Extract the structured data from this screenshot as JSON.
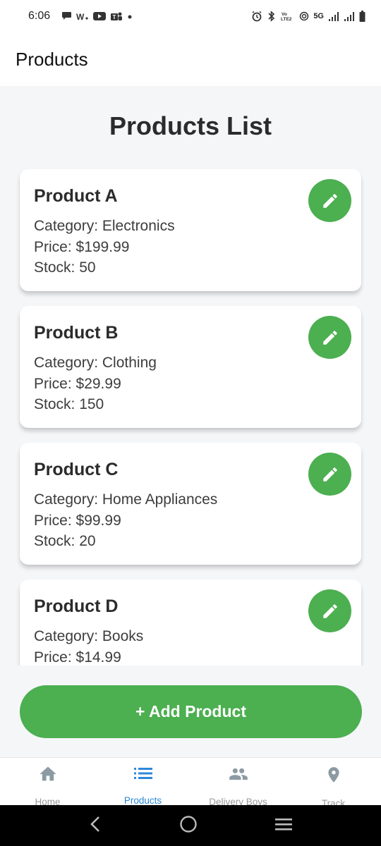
{
  "status_bar": {
    "time": "6:06",
    "network": "5G"
  },
  "app_bar": {
    "title": "Products"
  },
  "page": {
    "title": "Products List"
  },
  "products": [
    {
      "name": "Product A",
      "category": "Category: Electronics",
      "price": "Price: $199.99",
      "stock": "Stock: 50"
    },
    {
      "name": "Product B",
      "category": "Category: Clothing",
      "price": "Price: $29.99",
      "stock": "Stock: 150"
    },
    {
      "name": "Product C",
      "category": "Category: Home Appliances",
      "price": "Price: $99.99",
      "stock": "Stock: 20"
    },
    {
      "name": "Product D",
      "category": "Category: Books",
      "price": "Price: $14.99"
    }
  ],
  "actions": {
    "add_product": "+ Add Product"
  },
  "bottom_nav": {
    "items": [
      {
        "label": "Home",
        "icon": "home-icon"
      },
      {
        "label": "Products",
        "icon": "list-icon",
        "active": true
      },
      {
        "label": "Delivery Boys",
        "icon": "people-icon"
      },
      {
        "label": "Track",
        "icon": "location-pin-icon"
      }
    ]
  },
  "colors": {
    "accent": "#4caf50",
    "nav_active": "#2d88d8",
    "nav_inactive": "#9a9a9a"
  }
}
